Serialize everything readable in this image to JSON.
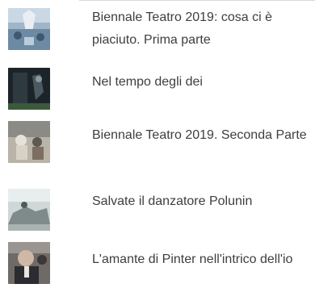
{
  "articles": [
    {
      "title": "Biennale Teatro 2019: cosa ci è piaciuto. Prima parte",
      "thumb": "theatre-stage-blue-thumbnail"
    },
    {
      "title": "Nel tempo degli dei",
      "thumb": "dark-stage-scene-thumbnail"
    },
    {
      "title": "Biennale Teatro 2019. Seconda Parte",
      "thumb": "performance-scene-thumbnail"
    },
    {
      "title": "Salvate il danzatore Polunin",
      "thumb": "dancer-scene-thumbnail"
    },
    {
      "title": "L'amante di Pinter nell'intrico dell'io",
      "thumb": "man-portrait-thumbnail"
    }
  ]
}
